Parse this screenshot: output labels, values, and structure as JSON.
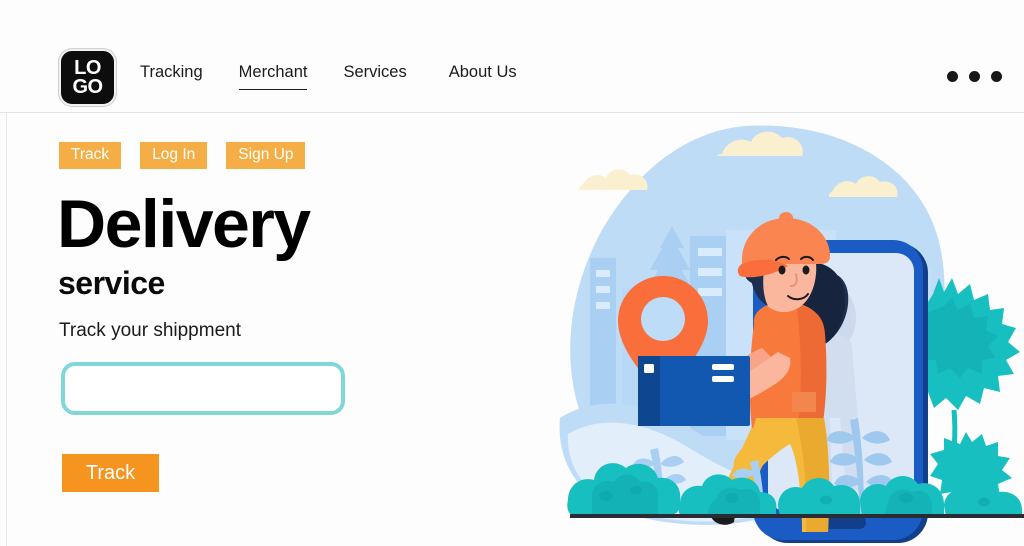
{
  "header": {
    "logo": {
      "line1": "LO",
      "line2": "GO",
      "name": "LOGO"
    },
    "nav": [
      {
        "label": "Tracking",
        "active": false
      },
      {
        "label": "Merchant",
        "active": true
      },
      {
        "label": "Services",
        "active": false
      },
      {
        "label": "About Us",
        "active": false
      }
    ],
    "menu_icon": "ellipsis-horizontal-icon"
  },
  "hero": {
    "tags": [
      {
        "label": "Track"
      },
      {
        "label": "Log In"
      },
      {
        "label": "Sign Up"
      }
    ],
    "headline": "Delivery",
    "subheadline": "service",
    "track_label": "Track your shippment",
    "input_value": "",
    "input_placeholder": "",
    "cta_label": "Track"
  },
  "illustration": {
    "name": "delivery-person-with-smartphone-illustration",
    "elements": [
      "background-blob",
      "clouds",
      "city-skyline",
      "location-pin",
      "package-box",
      "delivery-person",
      "smartphone",
      "trees",
      "bushes",
      "ground-line"
    ]
  },
  "colors": {
    "tag_amber": "#f5ae45",
    "cta_orange": "#f5941e",
    "input_border_teal": "#7fd7d8",
    "headline_black": "#000000",
    "pin_orange": "#f96e3a",
    "package_blue": "#1257b0",
    "phone_blue": "#1a5bc4",
    "phone_blue_dark": "#123f8a",
    "screen_blue": "#dce8f7",
    "foliage_teal": "#19bec0",
    "foliage_teal_dark": "#0ea5aa",
    "sky_blue": "#bcdcf7",
    "pants_yellow": "#f5ba3c",
    "shirt_orange": "#f7793c",
    "skin": "#f9a389",
    "hair_navy": "#1d2e4f",
    "cloud_cream": "#faf0cf"
  }
}
